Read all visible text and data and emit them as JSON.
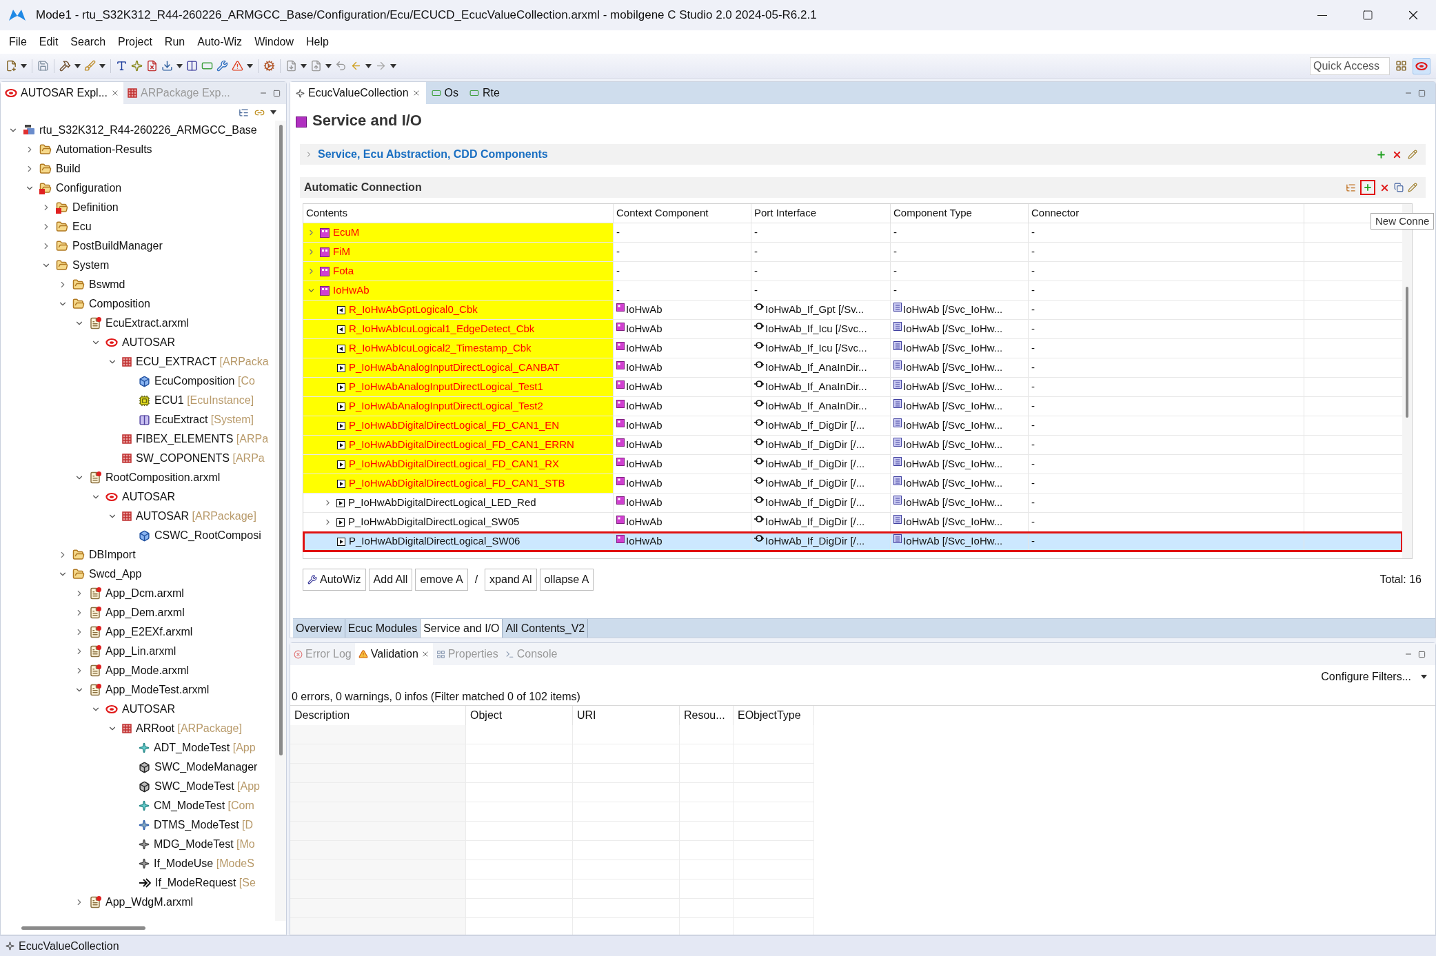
{
  "window": {
    "title": "Mode1 - rtu_S32K312_R44-260226_ARMGCC_Base/Configuration/Ecu/ECUCD_EcucValueCollection.arxml - mobilgene C Studio 2.0 2024-05-R6.2.1"
  },
  "menu": [
    "File",
    "Edit",
    "Search",
    "Project",
    "Run",
    "Auto-Wiz",
    "Window",
    "Help"
  ],
  "quick_access": {
    "placeholder": "Quick Access"
  },
  "explorer_tabs": [
    {
      "label": "AUTOSAR Expl...",
      "selected": true
    },
    {
      "label": "ARPackage Exp...",
      "selected": false
    }
  ],
  "tree": [
    {
      "label": "rtu_S32K312_R44-260226_ARMGCC_Base",
      "kind": "project",
      "expanded": true,
      "children": [
        {
          "label": "Automation-Results",
          "kind": "folder",
          "expanded": false
        },
        {
          "label": "Build",
          "kind": "folder",
          "expanded": false
        },
        {
          "label": "Configuration",
          "kind": "errorfolder",
          "expanded": true,
          "children": [
            {
              "label": "Definition",
              "kind": "errorfolder",
              "expanded": false
            },
            {
              "label": "Ecu",
              "kind": "folder",
              "expanded": false
            },
            {
              "label": "PostBuildManager",
              "kind": "folder",
              "expanded": false
            },
            {
              "label": "System",
              "kind": "folder",
              "expanded": true,
              "children": [
                {
                  "label": "Bswmd",
                  "kind": "folder",
                  "expanded": false
                },
                {
                  "label": "Composition",
                  "kind": "folder",
                  "expanded": true,
                  "children": [
                    {
                      "label": "EcuExtract.arxml",
                      "kind": "file",
                      "expanded": true,
                      "children": [
                        {
                          "label": "AUTOSAR",
                          "kind": "autosar",
                          "expanded": true,
                          "children": [
                            {
                              "label": "ECU_EXTRACT",
                              "type": "[ARPacka",
                              "kind": "package",
                              "expanded": true,
                              "children": [
                                {
                                  "label": "EcuComposition",
                                  "type": "[Co",
                                  "kind": "composition"
                                },
                                {
                                  "label": "ECU1",
                                  "type": "[EcuInstance]",
                                  "kind": "ecu"
                                },
                                {
                                  "label": "EcuExtract",
                                  "type": "[System]",
                                  "kind": "system"
                                }
                              ]
                            },
                            {
                              "label": "FIBEX_ELEMENTS",
                              "type": "[ARPa",
                              "kind": "package"
                            },
                            {
                              "label": "SW_COPONENTS",
                              "type": "[ARPa",
                              "kind": "package"
                            }
                          ]
                        }
                      ]
                    },
                    {
                      "label": "RootComposition.arxml",
                      "kind": "file",
                      "expanded": true,
                      "children": [
                        {
                          "label": "AUTOSAR",
                          "kind": "autosar",
                          "expanded": true,
                          "children": [
                            {
                              "label": "AUTOSAR",
                              "type": "[ARPackage]",
                              "kind": "package",
                              "expanded": true,
                              "children": [
                                {
                                  "label": "CSWC_RootComposi",
                                  "kind": "composition"
                                }
                              ]
                            }
                          ]
                        }
                      ]
                    }
                  ]
                },
                {
                  "label": "DBImport",
                  "kind": "folder",
                  "expanded": false
                },
                {
                  "label": "Swcd_App",
                  "kind": "folder",
                  "expanded": true,
                  "children": [
                    {
                      "label": "App_Dcm.arxml",
                      "kind": "file",
                      "expanded": false
                    },
                    {
                      "label": "App_Dem.arxml",
                      "kind": "file",
                      "expanded": false
                    },
                    {
                      "label": "App_E2EXf.arxml",
                      "kind": "file",
                      "expanded": false
                    },
                    {
                      "label": "App_Lin.arxml",
                      "kind": "file",
                      "expanded": false
                    },
                    {
                      "label": "App_Mode.arxml",
                      "kind": "file",
                      "expanded": false
                    },
                    {
                      "label": "App_ModeTest.arxml",
                      "kind": "file",
                      "expanded": true,
                      "children": [
                        {
                          "label": "AUTOSAR",
                          "kind": "autosar",
                          "expanded": true,
                          "children": [
                            {
                              "label": "ARRoot",
                              "type": "[ARPackage]",
                              "kind": "package",
                              "expanded": true,
                              "children": [
                                {
                                  "label": "ADT_ModeTest",
                                  "type": "[App",
                                  "kind": "datatype"
                                },
                                {
                                  "label": "SWC_ModeManager",
                                  "kind": "swc"
                                },
                                {
                                  "label": "SWC_ModeTest",
                                  "type": "[App",
                                  "kind": "swc"
                                },
                                {
                                  "label": "CM_ModeTest",
                                  "type": "[Com",
                                  "kind": "datatype"
                                },
                                {
                                  "label": "DTMS_ModeTest",
                                  "type": "[D",
                                  "kind": "mapping"
                                },
                                {
                                  "label": "MDG_ModeTest",
                                  "type": "[Mo",
                                  "kind": "modegroup"
                                },
                                {
                                  "label": "If_ModeUse",
                                  "type": "[ModeS",
                                  "kind": "modegroup"
                                },
                                {
                                  "label": "If_ModeRequest",
                                  "type": "[Se",
                                  "kind": "service"
                                }
                              ]
                            }
                          ]
                        }
                      ]
                    },
                    {
                      "label": "App_WdgM.arxml",
                      "kind": "file",
                      "expanded": false
                    }
                  ]
                }
              ]
            }
          ]
        }
      ]
    }
  ],
  "editor_tabs": [
    {
      "label": "EcucValueCollection",
      "selected": true
    },
    {
      "label": "Os",
      "selected": false
    },
    {
      "label": "Rte",
      "selected": false
    }
  ],
  "page_title": "Service and I/O",
  "sections": [
    {
      "title": "Service, Ecu Abstraction, CDD Components",
      "expanded": false
    },
    {
      "title": "Automatic Connection"
    }
  ],
  "tooltip": "New Conne",
  "table": {
    "columns": [
      "Contents",
      "Context Component",
      "Port Interface",
      "Component Type",
      "Connector"
    ],
    "rows": [
      {
        "name": "EcuM",
        "kind": "component",
        "highlighted": true,
        "selected": false,
        "expanded": false,
        "context": "-",
        "port_interface": "-",
        "component_type": "-",
        "connector": "-"
      },
      {
        "name": "FiM",
        "kind": "component",
        "highlighted": true,
        "selected": false,
        "expanded": false,
        "context": "-",
        "port_interface": "-",
        "component_type": "-",
        "connector": "-"
      },
      {
        "name": "Fota",
        "kind": "component",
        "highlighted": true,
        "selected": false,
        "expanded": false,
        "context": "-",
        "port_interface": "-",
        "component_type": "-",
        "connector": "-"
      },
      {
        "name": "IoHwAb",
        "kind": "component",
        "highlighted": true,
        "selected": false,
        "expanded": true,
        "context": "-",
        "port_interface": "-",
        "component_type": "-",
        "connector": "-"
      },
      {
        "name": "R_IoHwAbGptLogical0_Cbk",
        "kind": "required",
        "highlighted": true,
        "selected": false,
        "context": "IoHwAb",
        "port_interface": "IoHwAb_If_Gpt [/Sv...",
        "component_type": "IoHwAb [/Svc_IoHw...",
        "connector": "-"
      },
      {
        "name": "R_IoHwAbIcuLogical1_EdgeDetect_Cbk",
        "kind": "required",
        "highlighted": true,
        "selected": false,
        "context": "IoHwAb",
        "port_interface": "IoHwAb_If_Icu [/Svc...",
        "component_type": "IoHwAb [/Svc_IoHw...",
        "connector": "-"
      },
      {
        "name": "R_IoHwAbIcuLogical2_Timestamp_Cbk",
        "kind": "required",
        "highlighted": true,
        "selected": false,
        "context": "IoHwAb",
        "port_interface": "IoHwAb_If_Icu [/Svc...",
        "component_type": "IoHwAb [/Svc_IoHw...",
        "connector": "-"
      },
      {
        "name": "P_IoHwAbAnalogInputDirectLogical_CANBAT",
        "kind": "provided",
        "highlighted": true,
        "selected": false,
        "context": "IoHwAb",
        "port_interface": "IoHwAb_If_AnaInDir...",
        "component_type": "IoHwAb [/Svc_IoHw...",
        "connector": "-"
      },
      {
        "name": "P_IoHwAbAnalogInputDirectLogical_Test1",
        "kind": "provided",
        "highlighted": true,
        "selected": false,
        "context": "IoHwAb",
        "port_interface": "IoHwAb_If_AnaInDir...",
        "component_type": "IoHwAb [/Svc_IoHw...",
        "connector": "-"
      },
      {
        "name": "P_IoHwAbAnalogInputDirectLogical_Test2",
        "kind": "provided",
        "highlighted": true,
        "selected": false,
        "context": "IoHwAb",
        "port_interface": "IoHwAb_If_AnaInDir...",
        "component_type": "IoHwAb [/Svc_IoHw...",
        "connector": "-"
      },
      {
        "name": "P_IoHwAbDigitalDirectLogical_FD_CAN1_EN",
        "kind": "provided",
        "highlighted": true,
        "selected": false,
        "context": "IoHwAb",
        "port_interface": "IoHwAb_If_DigDir [/...",
        "component_type": "IoHwAb [/Svc_IoHw...",
        "connector": "-"
      },
      {
        "name": "P_IoHwAbDigitalDirectLogical_FD_CAN1_ERRN",
        "kind": "provided",
        "highlighted": true,
        "selected": false,
        "context": "IoHwAb",
        "port_interface": "IoHwAb_If_DigDir [/...",
        "component_type": "IoHwAb [/Svc_IoHw...",
        "connector": "-"
      },
      {
        "name": "P_IoHwAbDigitalDirectLogical_FD_CAN1_RX",
        "kind": "provided",
        "highlighted": true,
        "selected": false,
        "context": "IoHwAb",
        "port_interface": "IoHwAb_If_DigDir [/...",
        "component_type": "IoHwAb [/Svc_IoHw...",
        "connector": "-"
      },
      {
        "name": "P_IoHwAbDigitalDirectLogical_FD_CAN1_STB",
        "kind": "provided",
        "highlighted": true,
        "selected": false,
        "context": "IoHwAb",
        "port_interface": "IoHwAb_If_DigDir [/...",
        "component_type": "IoHwAb [/Svc_IoHw...",
        "connector": "-"
      },
      {
        "name": "P_IoHwAbDigitalDirectLogical_LED_Red",
        "kind": "provided",
        "highlighted": false,
        "selected": false,
        "expanded": false,
        "context": "IoHwAb",
        "port_interface": "IoHwAb_If_DigDir [/...",
        "component_type": "IoHwAb [/Svc_IoHw...",
        "connector": "-"
      },
      {
        "name": "P_IoHwAbDigitalDirectLogical_SW05",
        "kind": "provided",
        "highlighted": false,
        "selected": false,
        "expanded": false,
        "context": "IoHwAb",
        "port_interface": "IoHwAb_If_DigDir [/...",
        "component_type": "IoHwAb [/Svc_IoHw...",
        "connector": "-"
      },
      {
        "name": "P_IoHwAbDigitalDirectLogical_SW06",
        "kind": "provided",
        "highlighted": false,
        "selected": true,
        "context": "IoHwAb",
        "port_interface": "IoHwAb_If_DigDir [/...",
        "component_type": "IoHwAb [/Svc_IoHw...",
        "connector": "-"
      }
    ]
  },
  "actions": [
    "AutoWiz",
    "Add All",
    "emove A",
    "/",
    "xpand Al",
    "ollapse A"
  ],
  "total": "Total: 16",
  "editor_pages": [
    {
      "label": "Overview",
      "selected": false
    },
    {
      "label": "Ecuc Modules",
      "selected": false
    },
    {
      "label": "Service and I/O",
      "selected": true
    },
    {
      "label": "All Contents_V2",
      "selected": false
    }
  ],
  "bottom_tabs": [
    {
      "label": "Error Log",
      "selected": false
    },
    {
      "label": "Validation",
      "selected": true
    },
    {
      "label": "Properties",
      "selected": false
    },
    {
      "label": "Console",
      "selected": false
    }
  ],
  "configure_filters": "Configure Filters...",
  "validation_summary": "0 errors, 0 warnings, 0 infos (Filter matched 0 of 102 items)",
  "validation_columns": [
    "Description",
    "Object",
    "URI",
    "Resou...",
    "EObjectType"
  ],
  "status_bar": "EcucValueCollection"
}
